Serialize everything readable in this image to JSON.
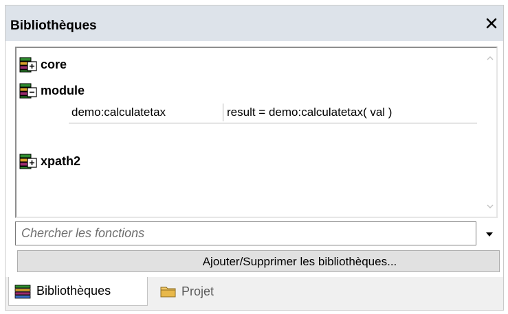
{
  "window": {
    "title": "Bibliothèques",
    "close_symbol": "✕"
  },
  "tree": {
    "nodes": [
      {
        "label": "core",
        "icon": "library-expand-icon",
        "expanded": false
      },
      {
        "label": "module",
        "icon": "library-collapse-icon",
        "expanded": true
      },
      {
        "label": "xpath2",
        "icon": "library-expand-icon",
        "expanded": false
      }
    ],
    "functions": [
      {
        "name": "demo:calculatetax",
        "signature": "result = demo:calculatetax( val )"
      }
    ]
  },
  "search": {
    "placeholder": "Chercher les fonctions",
    "value": ""
  },
  "action_button": {
    "label": "Ajouter/Supprimer les bibliothèques..."
  },
  "tabs": [
    {
      "label": "Bibliothèques",
      "icon": "libraries-icon",
      "active": true
    },
    {
      "label": "Projet",
      "icon": "folder-icon",
      "active": false
    }
  ],
  "colors": {
    "titlebar_bg": "#dde3ea",
    "accent_green": "#2e8b2e",
    "folder_yellow": "#e8b84a"
  }
}
